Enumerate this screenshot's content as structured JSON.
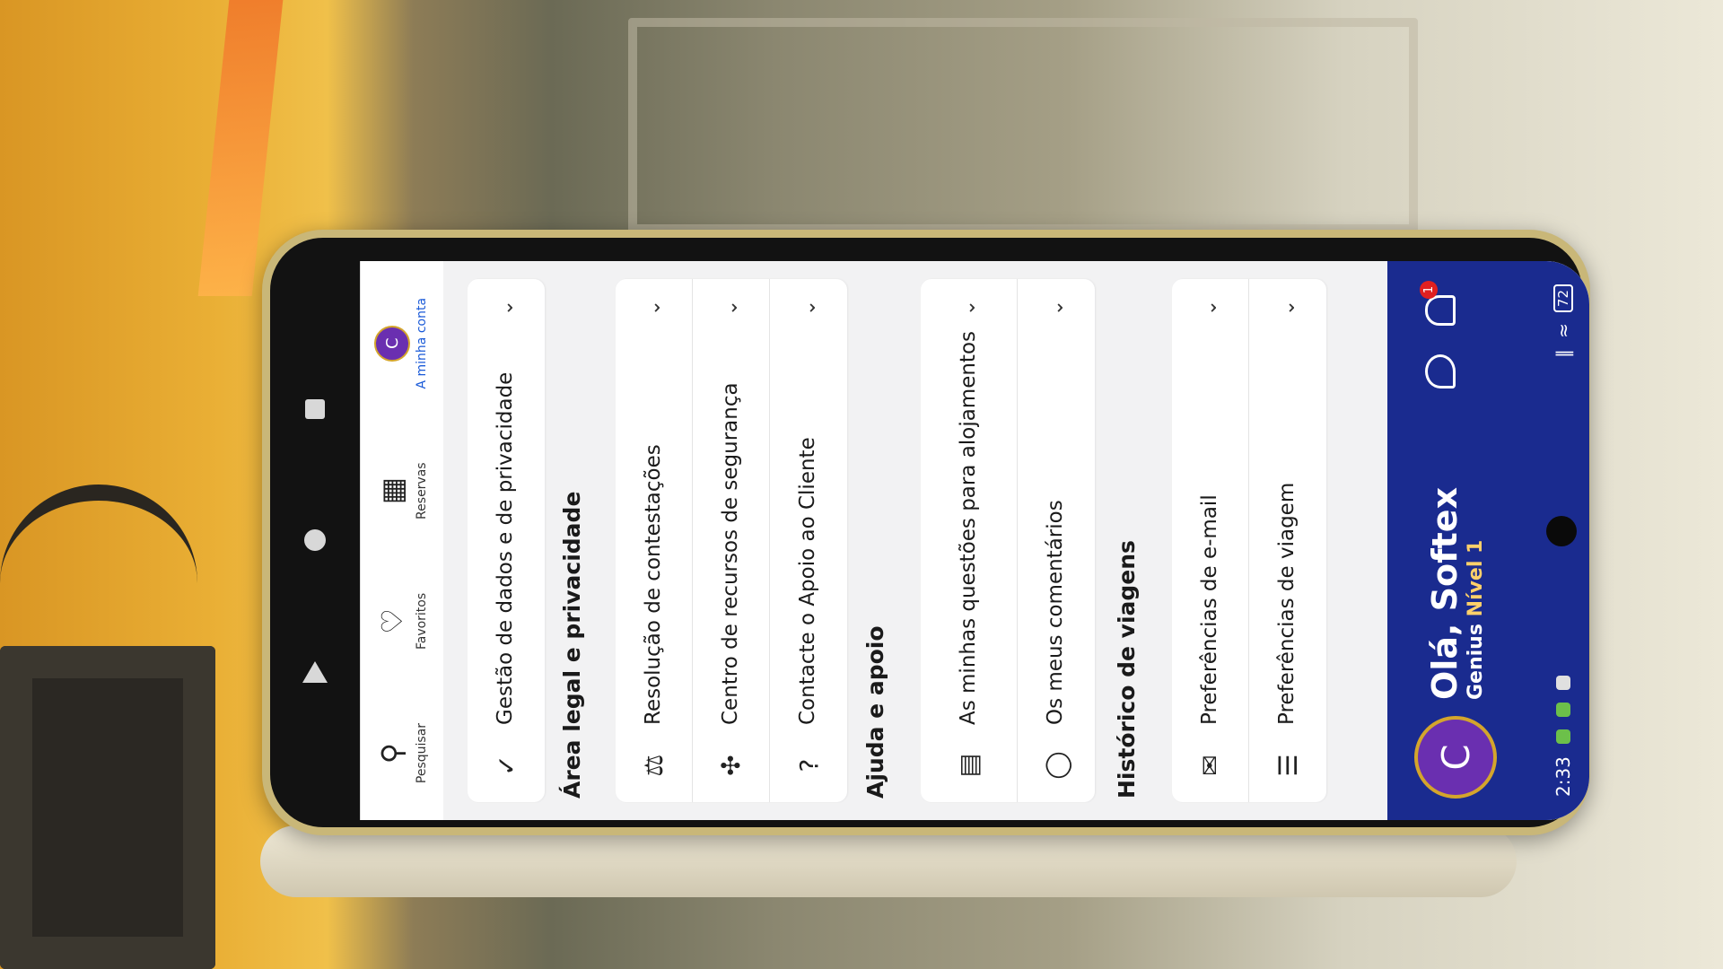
{
  "status_bar": {
    "time": "2:33",
    "battery": "72"
  },
  "header": {
    "avatar_letter": "C",
    "greeting": "Olá, Softex",
    "genius_prefix": "Genius",
    "genius_level": "Nível 1",
    "notification_count": "1"
  },
  "sections": {
    "manage": {
      "items": [
        {
          "icon": "sliders-icon",
          "label": "Preferências de viagem"
        },
        {
          "icon": "mail-icon",
          "label": "Preferências de e-mail"
        }
      ]
    },
    "history": {
      "title": "Histórico de viagens",
      "items": [
        {
          "icon": "chat-icon",
          "label": "Os meus comentários"
        },
        {
          "icon": "questions-icon",
          "label": "As minhas questões para alojamentos"
        }
      ]
    },
    "help": {
      "title": "Ajuda e apoio",
      "items": [
        {
          "icon": "question-icon",
          "label": "Contacte o Apoio ao Cliente"
        },
        {
          "icon": "lifebuoy-icon",
          "label": "Centro de recursos de segurança"
        },
        {
          "icon": "dispute-icon",
          "label": "Resolução de contestações"
        }
      ]
    },
    "legal": {
      "title": "Área legal e privacidade",
      "items": [
        {
          "icon": "shield-check-icon",
          "label": "Gestão de dados e de privacidade"
        }
      ]
    }
  },
  "tabbar": {
    "search": "Pesquisar",
    "favorites": "Favoritos",
    "bookings": "Reservas",
    "account": "A minha conta",
    "account_letter": "C"
  }
}
